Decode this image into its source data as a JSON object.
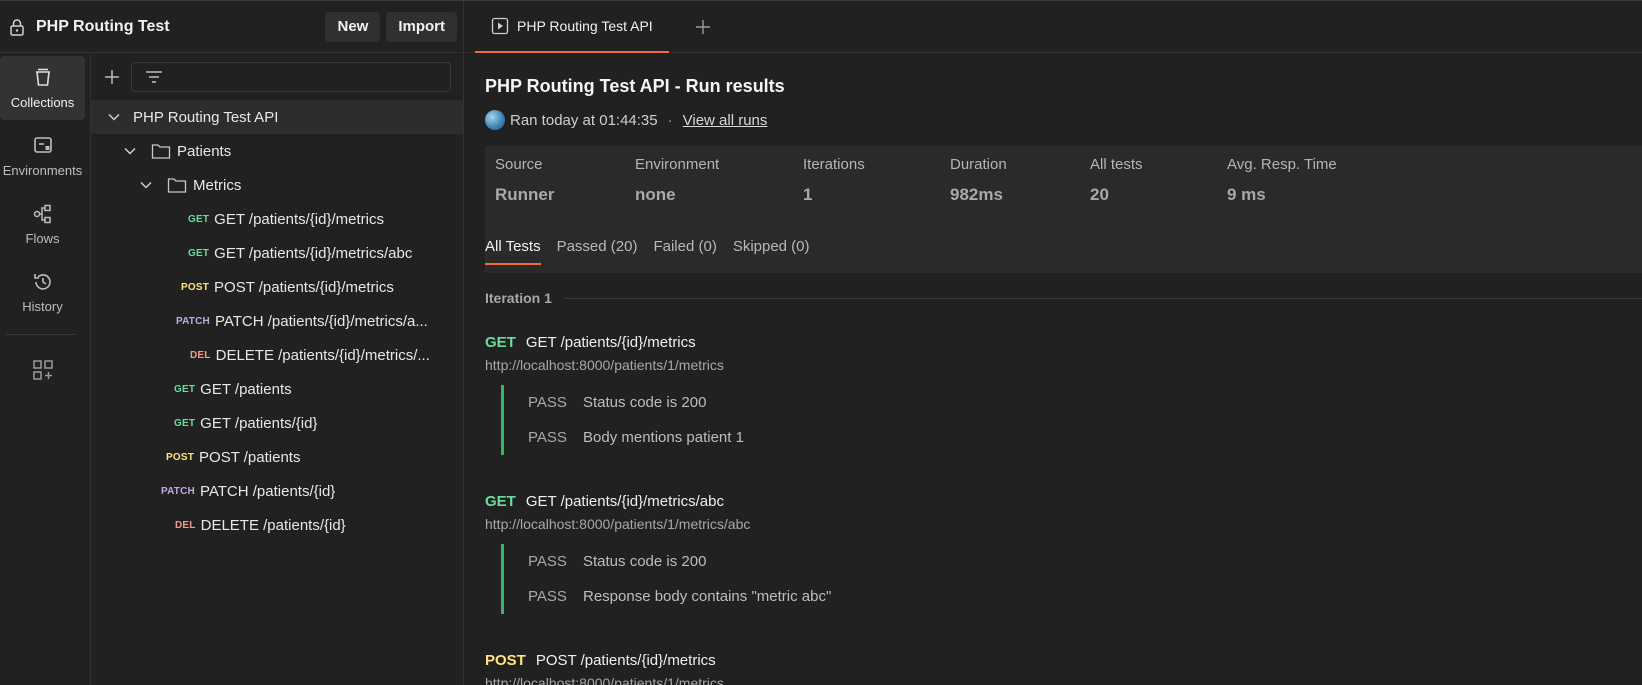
{
  "workspace": {
    "title": "PHP Routing Test",
    "new_label": "New",
    "import_label": "Import"
  },
  "rail": {
    "collections": "Collections",
    "environments": "Environments",
    "flows": "Flows",
    "history": "History"
  },
  "tree": {
    "collection": "PHP Routing Test API",
    "folder_patients": "Patients",
    "folder_metrics": "Metrics",
    "items": [
      {
        "method": "GET",
        "name": "GET /patients/{id}/metrics"
      },
      {
        "method": "GET",
        "name": "GET /patients/{id}/metrics/abc"
      },
      {
        "method": "POST",
        "name": "POST /patients/{id}/metrics"
      },
      {
        "method": "PATCH",
        "name": "PATCH /patients/{id}/metrics/a..."
      },
      {
        "method": "DEL",
        "name": "DELETE /patients/{id}/metrics/..."
      },
      {
        "method": "GET",
        "name": "GET /patients"
      },
      {
        "method": "GET",
        "name": "GET /patients/{id}"
      },
      {
        "method": "POST",
        "name": "POST /patients"
      },
      {
        "method": "PATCH",
        "name": "PATCH /patients/{id}"
      },
      {
        "method": "DEL",
        "name": "DELETE /patients/{id}"
      }
    ]
  },
  "tabs": {
    "active": "PHP Routing Test API"
  },
  "run": {
    "title": "PHP Routing Test API - Run results",
    "ran": "Ran today at 01:44:35",
    "sep": "·",
    "view_all": "View all runs",
    "summary": {
      "source_label": "Source",
      "source_value": "Runner",
      "env_label": "Environment",
      "env_value": "none",
      "iter_label": "Iterations",
      "iter_value": "1",
      "dur_label": "Duration",
      "dur_value": "982ms",
      "tests_label": "All tests",
      "tests_value": "20",
      "avg_label": "Avg. Resp. Time",
      "avg_value": "9 ms"
    },
    "filters": [
      "All Tests",
      "Passed (20)",
      "Failed (0)",
      "Skipped (0)"
    ],
    "iteration": "Iteration 1",
    "requests": [
      {
        "method": "GET",
        "name": "GET /patients/{id}/metrics",
        "url": "http://localhost:8000/patients/1/metrics",
        "results": [
          {
            "status": "PASS",
            "name": "Status code is 200"
          },
          {
            "status": "PASS",
            "name": "Body mentions patient 1"
          }
        ]
      },
      {
        "method": "GET",
        "name": "GET /patients/{id}/metrics/abc",
        "url": "http://localhost:8000/patients/1/metrics/abc",
        "results": [
          {
            "status": "PASS",
            "name": "Status code is 200"
          },
          {
            "status": "PASS",
            "name": "Response body contains \"metric abc\""
          }
        ]
      },
      {
        "method": "POST",
        "name": "POST /patients/{id}/metrics",
        "url": "http://localhost:8000/patients/1/metrics"
      }
    ]
  },
  "colors": {
    "accent": "#f26b3a",
    "get": "#6bdd9a",
    "post": "#ffe47e",
    "patch": "#c0a8e1",
    "delete": "#f79a8e",
    "pass_bar": "#2ebc62"
  }
}
